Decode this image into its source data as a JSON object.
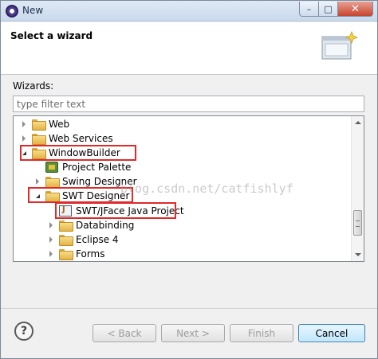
{
  "window": {
    "title": "New",
    "minimize_glyph": "–",
    "maximize_glyph": "□",
    "close_glyph": "✕"
  },
  "header": {
    "title": "Select a wizard"
  },
  "wizards": {
    "label": "Wizards:",
    "filter_placeholder": "type filter text"
  },
  "tree": {
    "items": [
      {
        "label": "Web",
        "state": "collapsed",
        "icon": "folder-icon"
      },
      {
        "label": "Web Services",
        "state": "collapsed",
        "icon": "folder-icon"
      },
      {
        "label": "WindowBuilder",
        "state": "expanded",
        "icon": "folder-icon"
      },
      {
        "label": "Project Palette",
        "state": "leaf",
        "icon": "palette-icon"
      },
      {
        "label": "Swing Designer",
        "state": "collapsed",
        "icon": "folder-icon"
      },
      {
        "label": "SWT Designer",
        "state": "expanded",
        "icon": "folder-icon"
      },
      {
        "label": "SWT/JFace Java Project",
        "state": "leaf",
        "icon": "java-project-icon"
      },
      {
        "label": "Databinding",
        "state": "collapsed",
        "icon": "folder-icon"
      },
      {
        "label": "Eclipse 4",
        "state": "collapsed",
        "icon": "folder-icon"
      },
      {
        "label": "Forms",
        "state": "collapsed",
        "icon": "folder-icon"
      }
    ]
  },
  "watermark": "blog.csdn.net/catfishlyf",
  "buttons": {
    "help": "?",
    "back": "< Back",
    "next": "Next >",
    "finish": "Finish",
    "cancel": "Cancel"
  },
  "highlight_color": "#e02a2a"
}
